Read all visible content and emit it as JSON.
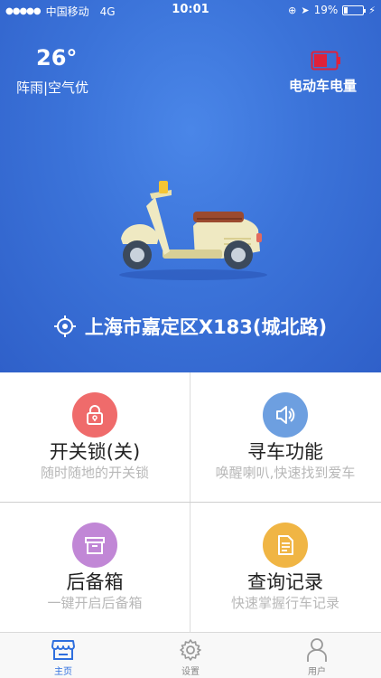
{
  "status_bar": {
    "carrier": "中国移动",
    "network": "4G",
    "time": "10:01",
    "battery_percent": "19%",
    "battery_level": 0.19
  },
  "weather": {
    "temperature": "26°",
    "description": "阵雨|空气优"
  },
  "ebike_battery": {
    "label": "电动车电量",
    "icon": "battery-low-icon"
  },
  "location": {
    "icon": "locate-icon",
    "text": "上海市嘉定区X183(城北路)"
  },
  "features": [
    {
      "title": "开关锁(关)",
      "subtitle": "随时随地的开关锁",
      "icon": "lock-icon",
      "color": "#ef6b6b"
    },
    {
      "title": "寻车功能",
      "subtitle": "唤醒喇叭,快速找到爱车",
      "icon": "speaker-icon",
      "color": "#6d9fe0"
    },
    {
      "title": "后备箱",
      "subtitle": "一键开启后备箱",
      "icon": "box-icon",
      "color": "#c187d6"
    },
    {
      "title": "查询记录",
      "subtitle": "快速掌握行车记录",
      "icon": "document-icon",
      "color": "#f0b544"
    }
  ],
  "tabs": [
    {
      "label": "主页",
      "icon": "store-icon",
      "active": true
    },
    {
      "label": "设置",
      "icon": "gear-icon",
      "active": false
    },
    {
      "label": "用户",
      "icon": "user-icon",
      "active": false
    }
  ],
  "colors": {
    "hero_blue": "#3b73d9",
    "tab_active": "#2f6fde",
    "subtitle_gray": "#b8b8b8"
  }
}
